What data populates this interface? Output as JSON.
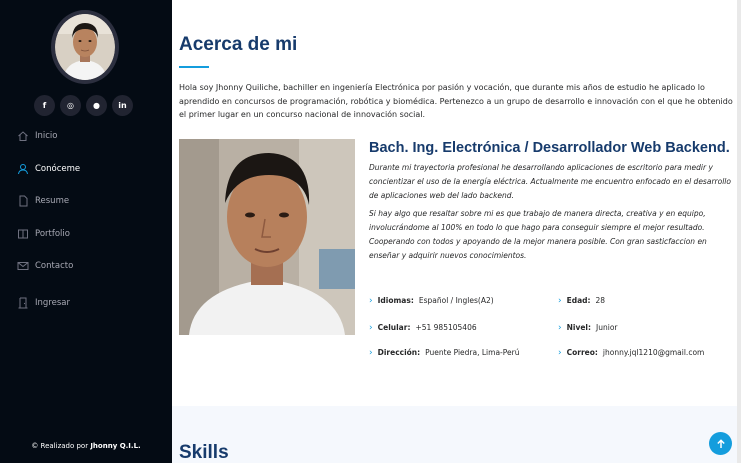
{
  "sidebar": {
    "socials": [
      {
        "icon": "facebook-icon",
        "glyph": "f"
      },
      {
        "icon": "instagram-icon",
        "glyph": "◎"
      },
      {
        "icon": "github-icon",
        "glyph": "●"
      },
      {
        "icon": "linkedin-icon",
        "glyph": "in"
      }
    ],
    "nav": [
      {
        "label": "Inicio",
        "icon": "home-icon",
        "active": false
      },
      {
        "label": "Conóceme",
        "icon": "user-icon",
        "active": true
      },
      {
        "label": "Resume",
        "icon": "file-icon",
        "active": false
      },
      {
        "label": "Portfolio",
        "icon": "book-icon",
        "active": false
      },
      {
        "label": "Contacto",
        "icon": "envelope-icon",
        "active": false
      },
      {
        "label": "Ingresar",
        "icon": "door-icon",
        "active": false
      }
    ],
    "credit_prefix": "© Realizado por ",
    "credit_name": "Jhonny Q.I.L."
  },
  "about": {
    "title": "Acerca de mi",
    "intro": "Hola soy Jhonny Quiliche, bachiller en ingeniería Electrónica por pasión y vocación, que durante mis años de estudio he aplicado lo aprendido en concursos de programación, robótica y biomédica. Pertenezco a un grupo de desarrollo e innovación con el que he obtenido el primer lugar en un concurso nacional de innovación social.",
    "role": "Bach. Ing. Electrónica / Desarrollador Web Backend.",
    "desc1": "Durante mi trayectoria profesional he desarrollando aplicaciones de escritorio para medir y concientizar el uso de la energía eléctrica. Actualmente me encuentro enfocado en el desarrollo de aplicaciones web del lado backend.",
    "desc2": "Si hay algo que resaltar sobre mi es que trabajo de manera directa, creativa y en equipo, involucrándome al 100% en todo lo que hago para conseguir siempre el mejor resultado. Cooperando con todos y apoyando de la mejor manera posible. Con gran sasticfaccion en enseñar y adquirir nuevos conocimientos.",
    "facts": [
      {
        "label": "Idiomas:",
        "value": "Español / Ingles(A2)"
      },
      {
        "label": "Edad:",
        "value": "28"
      },
      {
        "label": "Celular:",
        "value": "+51 985105406"
      },
      {
        "label": "Nivel:",
        "value": "Junior"
      },
      {
        "label": "Dirección:",
        "value": "Puente Piedra, Lima-Perú"
      },
      {
        "label": "Correo:",
        "value": "jhonny.jql1210@gmail.com"
      }
    ]
  },
  "skills": {
    "title": "Skills"
  },
  "colors": {
    "accent": "#149ddd",
    "sidebar": "#040b14",
    "heading": "#173b6c"
  }
}
